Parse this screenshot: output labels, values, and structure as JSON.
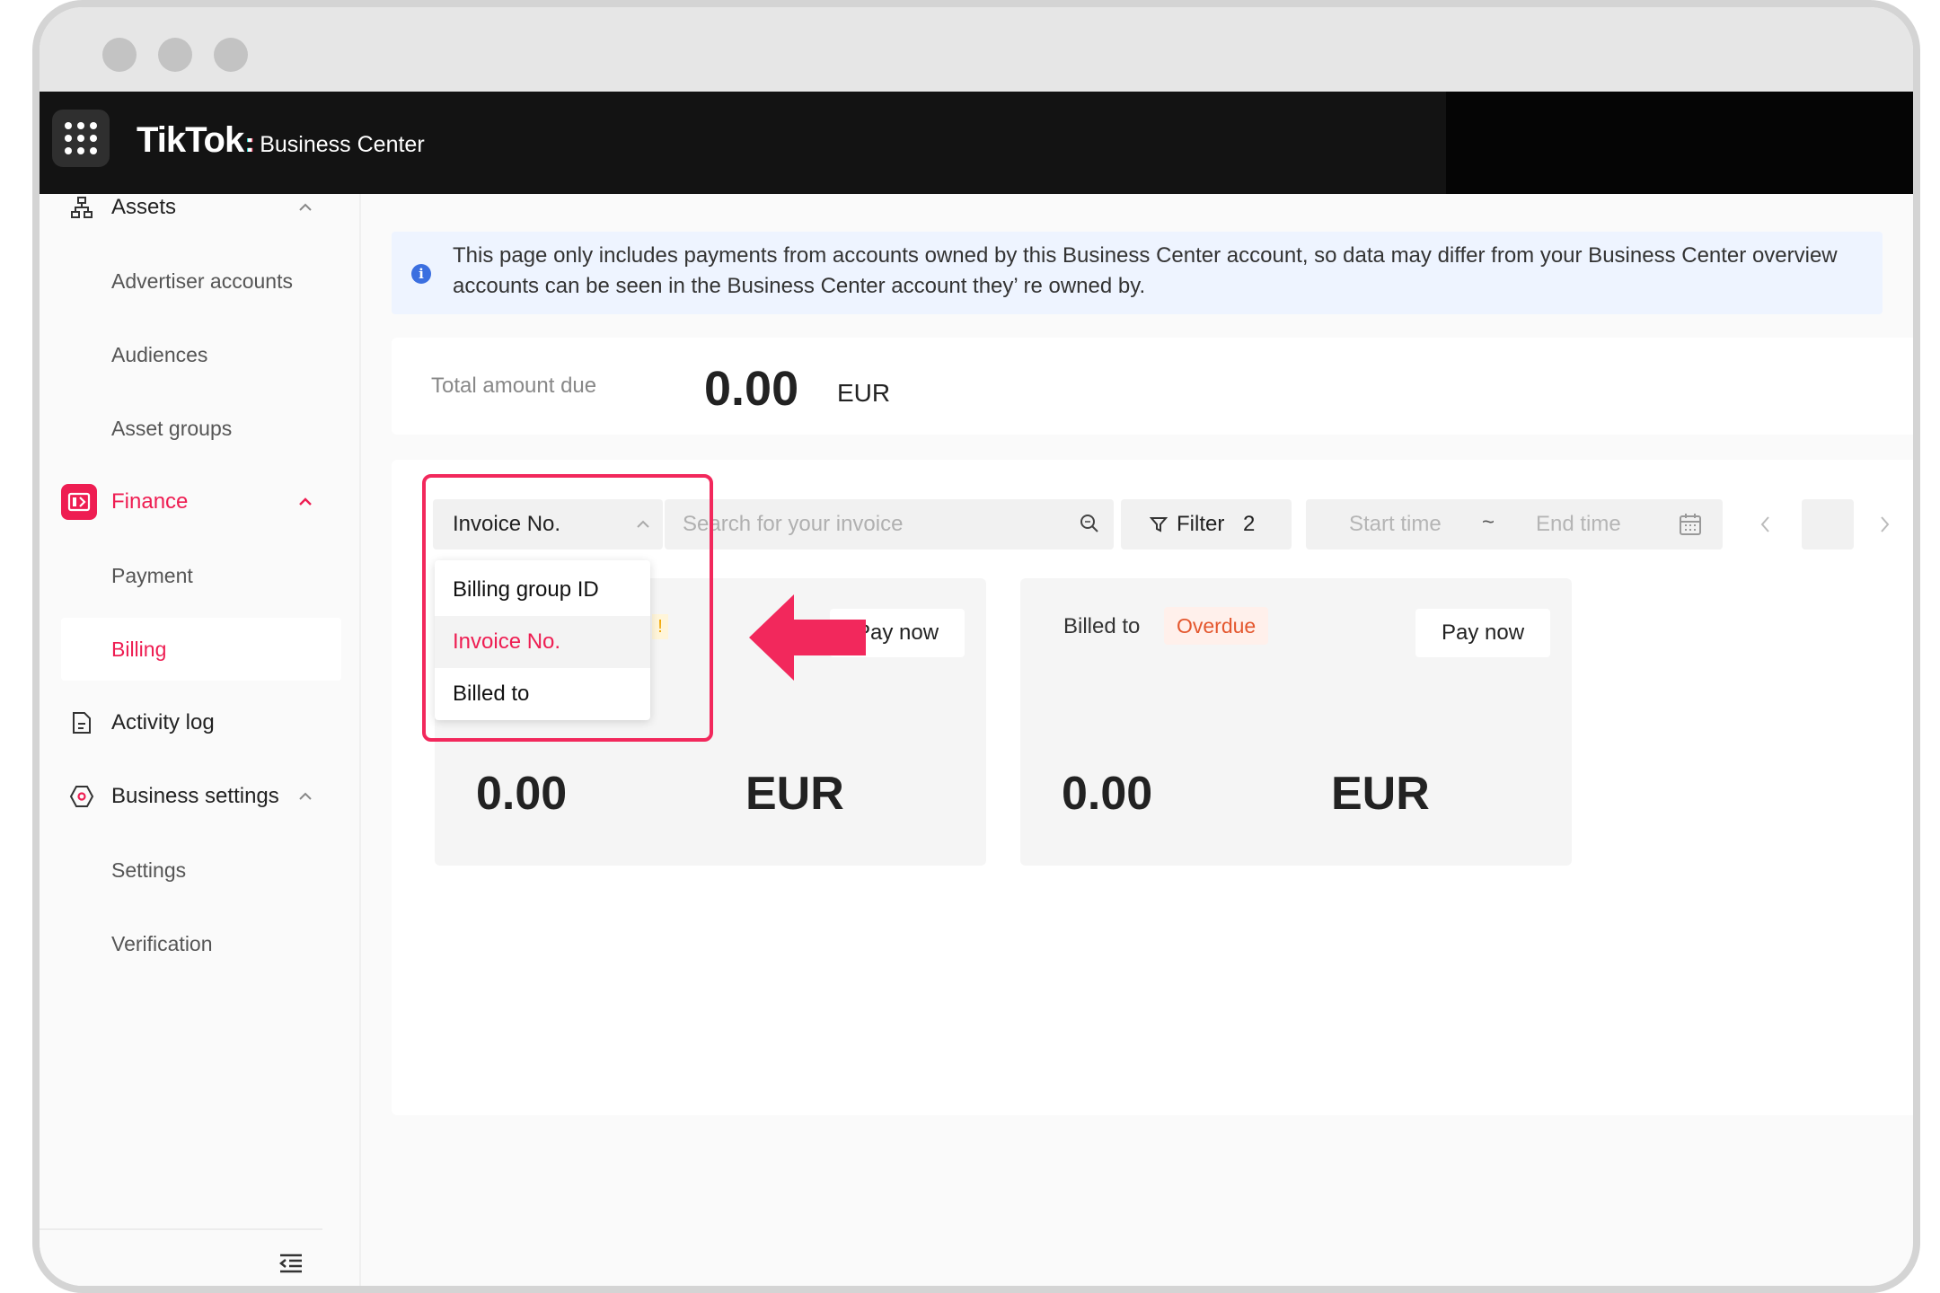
{
  "header": {
    "logo": "TikTok",
    "colon": ":",
    "product": "Business Center"
  },
  "sidebar": {
    "groups": [
      {
        "label": "Assets",
        "icon": "assets-icon",
        "items": [
          "Advertiser accounts",
          "Audiences",
          "Asset groups"
        ]
      },
      {
        "label": "Finance",
        "icon": "finance-icon",
        "items": [
          "Payment",
          "Billing"
        ]
      },
      {
        "label": "Activity log",
        "icon": "activity-log-icon"
      },
      {
        "label": "Business settings",
        "icon": "business-settings-icon",
        "items": [
          "Settings",
          "Verification"
        ]
      }
    ],
    "active_item": "Billing"
  },
  "banner": {
    "text": "This page only includes payments from accounts owned by this Business Center account, so data may differ from your Business Center overview accounts can be seen in the Business Center account they’ re owned by."
  },
  "total": {
    "label": "Total amount due",
    "amount": "0.00",
    "currency": "EUR"
  },
  "toolbar": {
    "search_type": "Invoice No.",
    "search_placeholder": "Search for your invoice",
    "filter_label": "Filter",
    "filter_count": "2",
    "start_placeholder": "Start time",
    "tilde": "~",
    "end_placeholder": "End time"
  },
  "dropdown": {
    "options": [
      "Billing group ID",
      "Invoice No.",
      "Billed to"
    ],
    "selected": "Invoice No."
  },
  "cards": [
    {
      "billed_label": "",
      "status": "",
      "status_peek": "!",
      "pay_label": "Pay now",
      "amount": "0.00",
      "currency": "EUR"
    },
    {
      "billed_label": "Billed to",
      "status": "Overdue",
      "pay_label": "Pay now",
      "amount": "0.00",
      "currency": "EUR"
    }
  ],
  "colors": {
    "accent": "#ee1d52",
    "highlight": "#f2285c",
    "overdue": "#e4572e",
    "header_bg": "#131313"
  }
}
